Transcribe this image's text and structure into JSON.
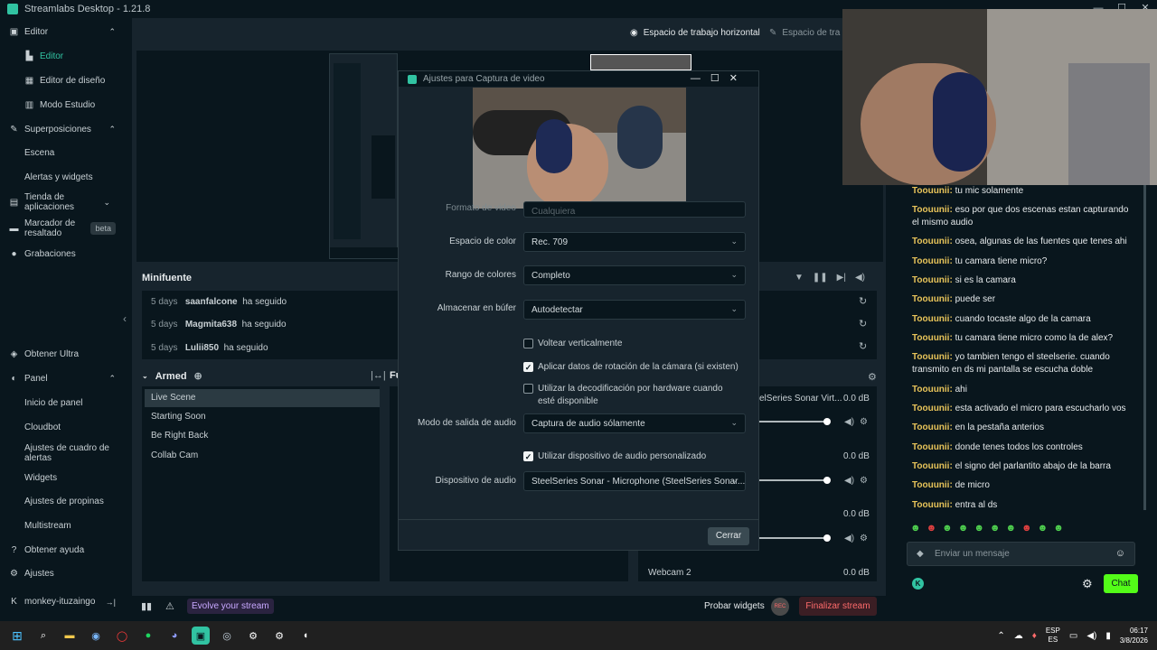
{
  "app": {
    "title": "Streamlabs Desktop - 1.21.8"
  },
  "sidebar": {
    "editor_section": "Editor",
    "items": [
      {
        "label": "Editor"
      },
      {
        "label": "Editor de diseño"
      },
      {
        "label": "Modo Estudio"
      }
    ],
    "overlays_section": "Superposiciones",
    "overlay_items": [
      {
        "label": "Escena"
      },
      {
        "label": "Alertas y widgets"
      }
    ],
    "app_store": "Tienda de aplicaciones",
    "highlighter": "Marcador de resaltado",
    "highlighter_badge": "beta",
    "recordings": "Grabaciones",
    "get_ultra": "Obtener Ultra",
    "panel_section": "Panel",
    "panel_items": [
      {
        "label": "Inicio de panel"
      },
      {
        "label": "Cloudbot"
      },
      {
        "label": "Ajustes de cuadro de alertas"
      },
      {
        "label": "Widgets"
      },
      {
        "label": "Ajustes de propinas"
      },
      {
        "label": "Multistream"
      }
    ],
    "help": "Obtener ayuda",
    "settings": "Ajustes",
    "user": "monkey-ituzaingo"
  },
  "workspace": {
    "horizontal": "Espacio de trabajo horizontal",
    "vertical": "Espacio de tra"
  },
  "minifeed": {
    "title": "Minifuente",
    "events": [
      {
        "time": "5 days",
        "user": "saanfalcone",
        "action": "ha seguido"
      },
      {
        "time": "5 days",
        "user": "Magmita638",
        "action": "ha seguido"
      },
      {
        "time": "5 days",
        "user": "Lulii850",
        "action": "ha seguido"
      }
    ]
  },
  "scenes": {
    "collection": "Armed",
    "sources_header": "Fu",
    "items": [
      "Live Scene",
      "Starting Soon",
      "Be Right Back",
      "Collab Cam"
    ]
  },
  "mixer": {
    "tracks": [
      {
        "name": "elSeries Sonar Virt...",
        "db": "0.0 dB",
        "level": 0.97
      },
      {
        "name": "",
        "db": "0.0 dB",
        "level": 0.97
      },
      {
        "name": "",
        "db": "0.0 dB",
        "level": 0.97
      },
      {
        "name": "Webcam 2",
        "db": "0.0 dB"
      }
    ]
  },
  "dialog": {
    "title": "Ajustes para Captura de video",
    "rows": [
      {
        "label": "Formato de video",
        "value": "Cualquiera"
      },
      {
        "label": "Espacio de color",
        "value": "Rec. 709"
      },
      {
        "label": "Rango de colores",
        "value": "Completo"
      },
      {
        "label": "Almacenar en búfer",
        "value": "Autodetectar"
      }
    ],
    "checks": [
      {
        "label": "Voltear verticalmente",
        "checked": false
      },
      {
        "label": "Aplicar datos de rotación de la cámara (si existen)",
        "checked": true
      },
      {
        "label": "Utilizar la decodificación por hardware cuando esté disponible",
        "checked": false
      }
    ],
    "audio_output_label": "Modo de salida de audio",
    "audio_output_value": "Captura de audio sólamente",
    "custom_audio_label": "Utilizar dispositivo de audio personalizado",
    "audio_device_label": "Dispositivo de audio",
    "audio_device_value": "SteelSeries Sonar - Microphone (SteelSeries Sonar...",
    "close": "Cerrar"
  },
  "chat": {
    "messages": [
      {
        "user": "Toouunii:",
        "text": "tu mic solamente"
      },
      {
        "user": "Toouunii:",
        "text": "eso por que dos escenas estan capturando el mismo audio"
      },
      {
        "user": "Toouunii:",
        "text": "osea, algunas de las fuentes que tenes ahi"
      },
      {
        "user": "Toouunii:",
        "text": "tu camara tiene micro?"
      },
      {
        "user": "Toouunii:",
        "text": "si es la camara"
      },
      {
        "user": "Toouunii:",
        "text": "puede ser"
      },
      {
        "user": "Toouunii:",
        "text": "cuando tocaste algo de la camara"
      },
      {
        "user": "Toouunii:",
        "text": "tu camara tiene micro como la de alex?"
      },
      {
        "user": "Toouunii:",
        "text": "yo tambien tengo el steelserie. cuando transmito en ds mi pantalla se escucha doble"
      },
      {
        "user": "Toouunii:",
        "text": "ahi"
      },
      {
        "user": "Toouunii:",
        "text": "esta activado el micro para escucharlo vos"
      },
      {
        "user": "Toouunii:",
        "text": "en la pestaña anterios"
      },
      {
        "user": "Toouunii:",
        "text": "donde tenes todos los controles"
      },
      {
        "user": "Toouunii:",
        "text": "el signo del parlantito abajo de la barra"
      },
      {
        "user": "Toouunii:",
        "text": "de micro"
      },
      {
        "user": "Toouunii:",
        "text": "entra al ds"
      }
    ],
    "placeholder": "Enviar un mensaje",
    "send": "Chat"
  },
  "bottom": {
    "evolve": "Evolve your stream",
    "test_widgets": "Probar widgets",
    "rec": "REC",
    "end_stream": "Finalizar stream"
  },
  "taskbar": {
    "lang1": "ESP",
    "lang2": "ES",
    "time": "06:17",
    "date": "3/8/2026"
  },
  "colors": {
    "accent": "#31c3a2",
    "chat_user": "#e8c45a",
    "end_stream": "#ff5f5f"
  }
}
